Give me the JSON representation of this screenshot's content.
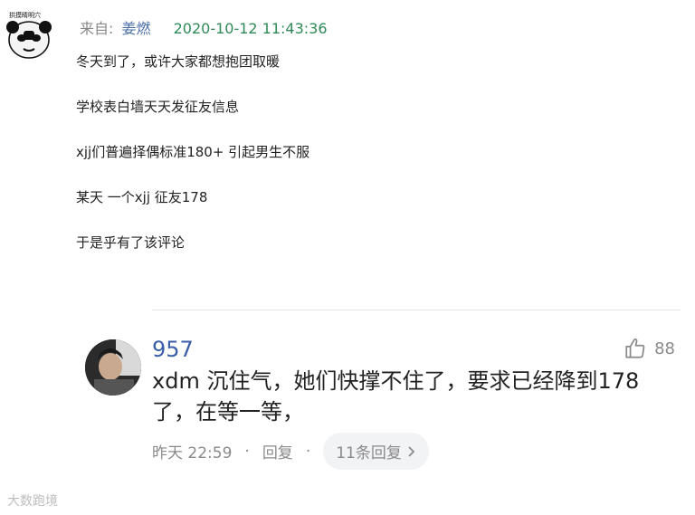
{
  "post": {
    "from_label": "来自:",
    "author": "姜燃",
    "timestamp": "2020-10-12 11:43:36",
    "avatar_caption": "拱摸睛明穴",
    "lines": [
      "冬天到了，或许大家都想抱团取暖",
      "学校表白墙天天发征友信息",
      "xjj们普遍择偶标准180+ 引起男生不服",
      "某天 一个xjj 征友178",
      "于是乎有了该评论"
    ]
  },
  "reply": {
    "username": "957",
    "likes": "88",
    "text": "xdm 沉住气，她们快撑不住了，要求已经降到178了，在等一等，",
    "time": "昨天 22:59",
    "reply_label": "回复",
    "replies_count_label": "11条回复"
  },
  "watermark": "大数跑境",
  "colors": {
    "author": "#4a6fa5",
    "timestamp": "#2e8b57",
    "username": "#3a5ea8",
    "muted": "#8a8a8a"
  }
}
